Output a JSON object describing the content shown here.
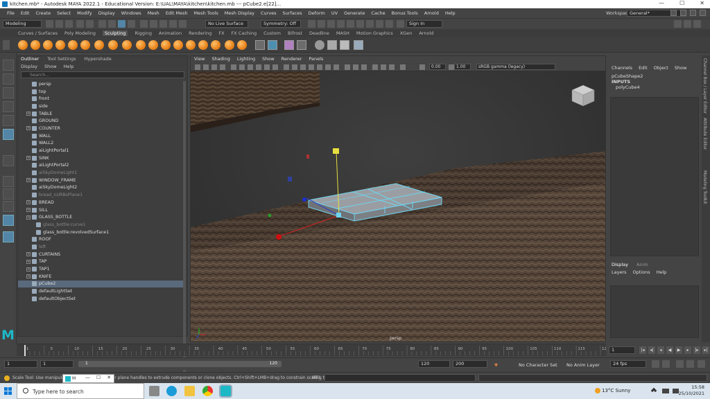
{
  "window": {
    "title": "kitchen.mb* - Autodesk MAYA 2022.1 - Educational Version: E:\\UAL\\MAYA\\kitchen\\kitchen.mb  ---  pCube2.e[22]...",
    "min": "—",
    "max": "☐",
    "close": "✕"
  },
  "menubar": {
    "items": [
      "File",
      "Edit",
      "Create",
      "Select",
      "Modify",
      "Display",
      "Windows",
      "Mesh",
      "Edit Mesh",
      "Mesh Tools",
      "Mesh Display",
      "Curves",
      "Surfaces",
      "Deform",
      "UV",
      "Generate",
      "Cache",
      "Bonus Tools",
      "Arnold",
      "Help"
    ],
    "workspace_label": "Workspace:",
    "workspace_value": "General*"
  },
  "statusline": {
    "mode": "Modeling",
    "live_surface": "No Live Surface",
    "symmetry": "Symmetry: Off",
    "signin": "Sign In"
  },
  "shelf": {
    "tabs": [
      "Curves / Surfaces",
      "Poly Modeling",
      "Sculpting",
      "Rigging",
      "Animation",
      "Rendering",
      "FX",
      "FX Caching",
      "Custom",
      "Bifrost",
      "Deadline",
      "MASH",
      "Motion Graphics",
      "XGen",
      "Arnold"
    ],
    "active_tab": "Sculpting"
  },
  "outliner": {
    "tabs": [
      "Outliner",
      "Tool Settings",
      "Hypershade"
    ],
    "menus": [
      "Display",
      "Show",
      "Help"
    ],
    "search_placeholder": "Search...",
    "items": [
      {
        "label": "persp",
        "expand": false,
        "dim": false,
        "sel": false,
        "indent": 0
      },
      {
        "label": "top",
        "expand": false,
        "dim": false,
        "sel": false,
        "indent": 0
      },
      {
        "label": "front",
        "expand": false,
        "dim": false,
        "sel": false,
        "indent": 0
      },
      {
        "label": "side",
        "expand": false,
        "dim": false,
        "sel": false,
        "indent": 0
      },
      {
        "label": "TABLE",
        "expand": true,
        "dim": false,
        "sel": false,
        "indent": 0
      },
      {
        "label": "GROUND",
        "expand": false,
        "dim": false,
        "sel": false,
        "indent": 0
      },
      {
        "label": "COUNTER",
        "expand": true,
        "dim": false,
        "sel": false,
        "indent": 0
      },
      {
        "label": "WALL",
        "expand": false,
        "dim": false,
        "sel": false,
        "indent": 0
      },
      {
        "label": "WALL2",
        "expand": false,
        "dim": false,
        "sel": false,
        "indent": 0
      },
      {
        "label": "aiLightPortal1",
        "expand": false,
        "dim": false,
        "sel": false,
        "indent": 0
      },
      {
        "label": "SINK",
        "expand": true,
        "dim": false,
        "sel": false,
        "indent": 0
      },
      {
        "label": "aiLightPortal2",
        "expand": false,
        "dim": false,
        "sel": false,
        "indent": 0
      },
      {
        "label": "aiSkyDomeLight1",
        "expand": false,
        "dim": true,
        "sel": false,
        "indent": 0
      },
      {
        "label": "WINDOW_FRAME",
        "expand": true,
        "dim": false,
        "sel": false,
        "indent": 0
      },
      {
        "label": "aiSkyDomeLight2",
        "expand": false,
        "dim": false,
        "sel": false,
        "indent": 0
      },
      {
        "label": "bread_nURBsPlane1",
        "expand": false,
        "dim": true,
        "sel": false,
        "indent": 0
      },
      {
        "label": "BREAD",
        "expand": true,
        "dim": false,
        "sel": false,
        "indent": 0
      },
      {
        "label": "SILL",
        "expand": true,
        "dim": false,
        "sel": false,
        "indent": 0
      },
      {
        "label": "GLASS_BOTTLE",
        "expand": true,
        "dim": false,
        "sel": false,
        "indent": 0
      },
      {
        "label": "glass_bottle:curve1",
        "expand": false,
        "dim": true,
        "sel": false,
        "indent": 1
      },
      {
        "label": "glass_bottle:revolvedSurface1",
        "expand": false,
        "dim": false,
        "sel": false,
        "indent": 1
      },
      {
        "label": "ROOF",
        "expand": false,
        "dim": false,
        "sel": false,
        "indent": 0
      },
      {
        "label": "left",
        "expand": false,
        "dim": true,
        "sel": false,
        "indent": 0
      },
      {
        "label": "CURTAINS",
        "expand": true,
        "dim": false,
        "sel": false,
        "indent": 0
      },
      {
        "label": "TAP",
        "expand": true,
        "dim": false,
        "sel": false,
        "indent": 0
      },
      {
        "label": "TAP1",
        "expand": true,
        "dim": false,
        "sel": false,
        "indent": 0
      },
      {
        "label": "KNIFE",
        "expand": true,
        "dim": false,
        "sel": false,
        "indent": 0
      },
      {
        "label": "pCube2",
        "expand": false,
        "dim": false,
        "sel": true,
        "indent": 0
      },
      {
        "label": "defaultLightSet",
        "expand": false,
        "dim": false,
        "sel": false,
        "indent": -1
      },
      {
        "label": "defaultObjectSet",
        "expand": false,
        "dim": false,
        "sel": false,
        "indent": -1
      }
    ]
  },
  "viewport": {
    "menus": [
      "View",
      "Shading",
      "Lighting",
      "Show",
      "Renderer",
      "Panels"
    ],
    "exposure": "0.00",
    "gamma": "1.00",
    "colorspace": "sRGB gamma (legacy)",
    "camera": "persp"
  },
  "channelbox": {
    "menus": [
      "Channels",
      "Edit",
      "Object",
      "Show"
    ],
    "shape": "pCubeShape2",
    "inputs_label": "INPUTS",
    "input_node": "polyCube4"
  },
  "layers": {
    "tabs": [
      "Display",
      "Anim"
    ],
    "menus": [
      "Layers",
      "Options",
      "Help"
    ]
  },
  "sidetabs": [
    "Channel Box / Layer Editor",
    "Attribute Editor",
    "Modeling Toolkit"
  ],
  "timeslider": {
    "ticks": [
      "1",
      "5",
      "10",
      "15",
      "20",
      "25",
      "30",
      "35",
      "40",
      "45",
      "50",
      "55",
      "60",
      "65",
      "70",
      "75",
      "80",
      "85",
      "90",
      "95",
      "100",
      "105",
      "110",
      "115",
      "120"
    ],
    "current_frame": "1"
  },
  "range": {
    "start": "1",
    "start2": "1",
    "slider_start": "1",
    "slider_end": "120",
    "end": "120",
    "end2": "200",
    "character_set": "No Character Set",
    "anim_layer": "No Anim Layer",
    "fps": "24 fps"
  },
  "helpline": {
    "text": "Scale Tool: Use manipulator t... ...nipulator axis or plane handles to extrude components or clone objects. Ctrl+Shift+LMB+drag to constrain scaling to",
    "mel": "MEL",
    "popup_label": "M"
  },
  "taskbar": {
    "search": "Type here to search",
    "weather": "13°C  Sunny",
    "time": "15:58",
    "date": "25/10/2021"
  }
}
